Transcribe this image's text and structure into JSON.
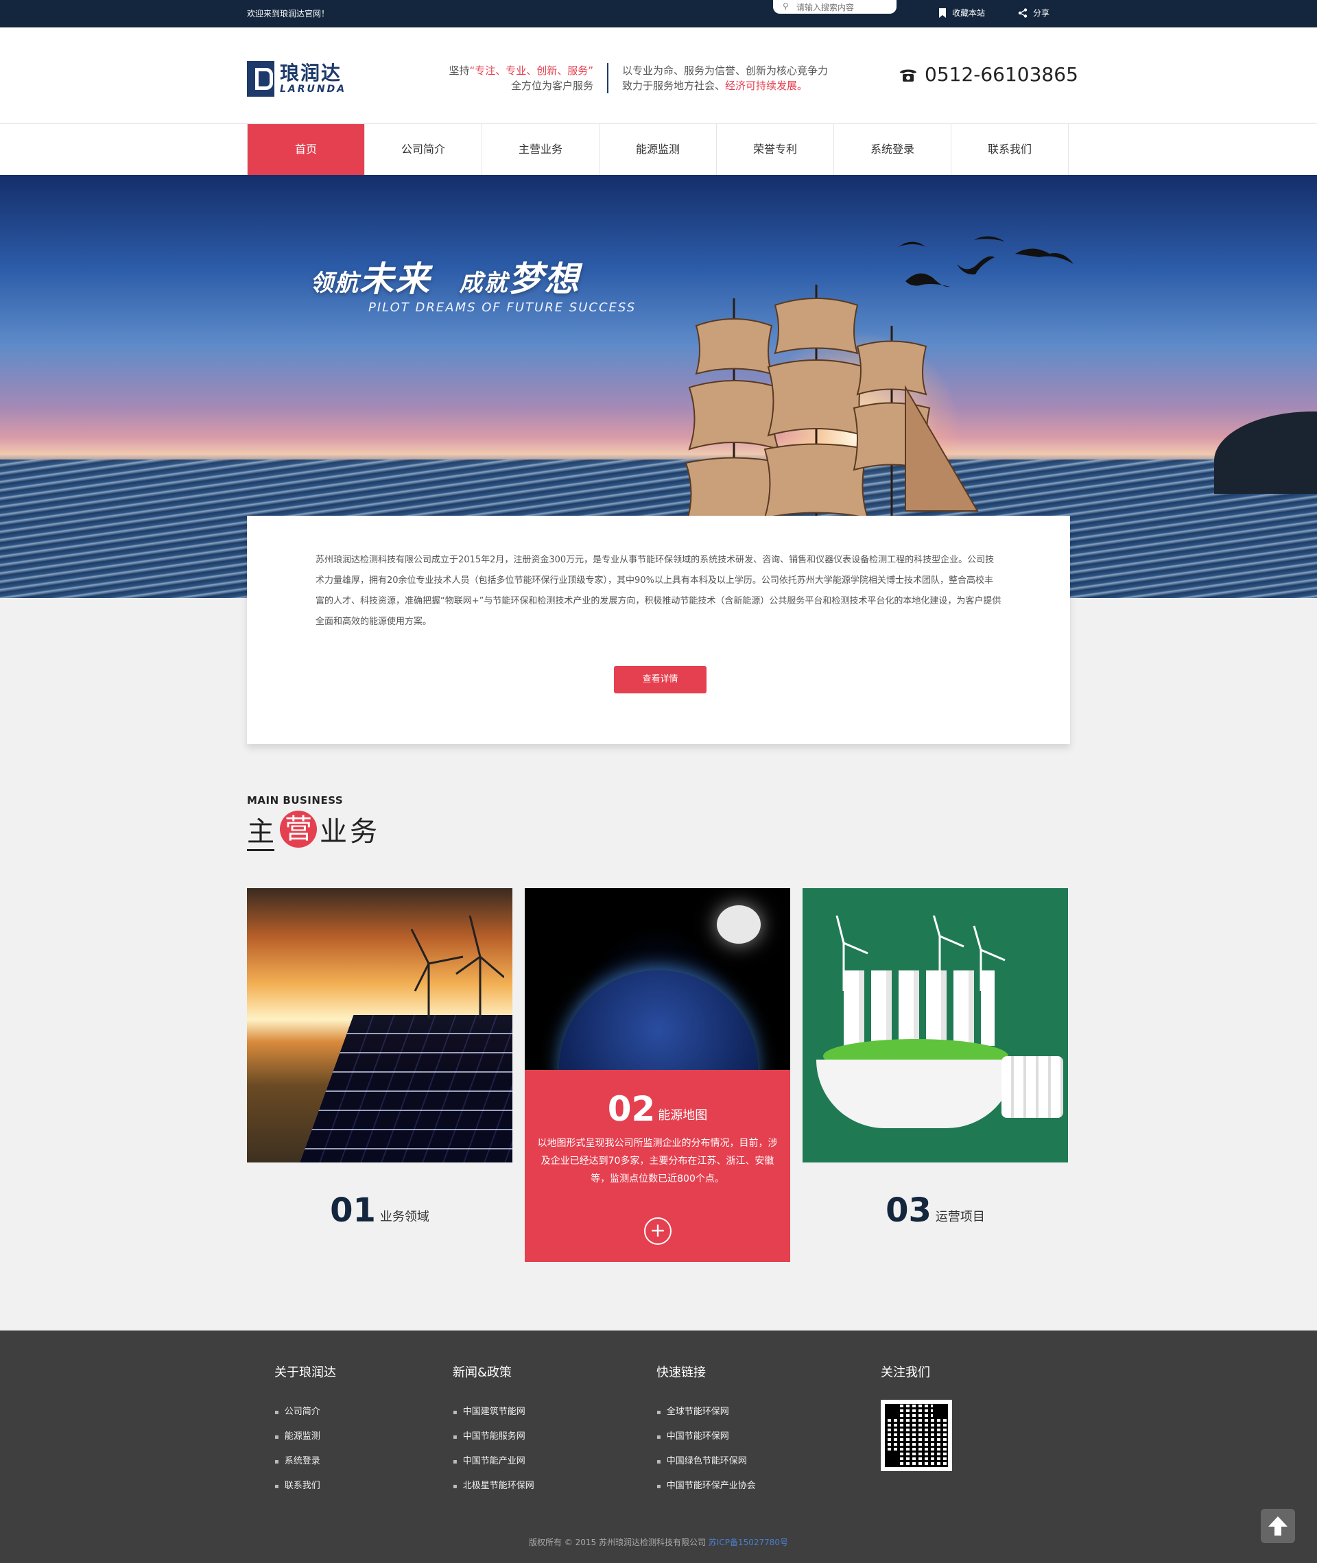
{
  "topbar": {
    "welcome": "欢迎来到琅润达官网！",
    "search_placeholder": "请输入搜索内容",
    "favorite": "收藏本站",
    "share": "分享"
  },
  "header": {
    "logo_cn": "琅润达",
    "logo_en": "LARUNDA",
    "slogan1_pre": "坚持",
    "slogan1_hl": "“专注、专业、创新、服务”",
    "slogan1_line2": "全方位为客户服务",
    "slogan2_line1": "以专业为命、服务为信誉、创新为核心竞争力",
    "slogan2_pre": "致力于服务地方社会、",
    "slogan2_hl": "经济可持续发展。",
    "phone": "0512-66103865"
  },
  "nav": {
    "items": [
      {
        "label": "首页"
      },
      {
        "label": "公司简介"
      },
      {
        "label": "主营业务"
      },
      {
        "label": "能源监测"
      },
      {
        "label": "荣誉专利"
      },
      {
        "label": "系统登录"
      },
      {
        "label": "联系我们"
      }
    ]
  },
  "banner": {
    "cn_part1_small": "领航",
    "cn_part1_big": "未来",
    "cn_part2_small": "成就",
    "cn_part2_big": "梦想",
    "en": "PILOT DREAMS OF FUTURE SUCCESS"
  },
  "intro": {
    "text": "苏州琅润达检测科技有限公司成立于2015年2月，注册资金300万元，是专业从事节能环保领域的系统技术研发、咨询、销售和仪器仪表设备检测工程的科技型企业。公司技术力量雄厚，拥有20余位专业技术人员（包括多位节能环保行业顶级专家），其中90%以上具有本科及以上学历。公司依托苏州大学能源学院相关博士技术团队，整合高校丰富的人才、科技资源，准确把握“物联网+”与节能环保和检测技术产业的发展方向，积极推动节能技术（含新能源）公共服务平台和检测技术平台化的本地化建设，为客户提供全面和高效的能源使用方案。",
    "button": "查看详情"
  },
  "business": {
    "title_en": "MAIN BUSINESS",
    "title_pre": "主",
    "title_circle": "营",
    "title_post": "业务",
    "cards": [
      {
        "num": "01",
        "label": "业务领域"
      },
      {
        "num": "02",
        "label": "能源地图",
        "desc": "以地图形式呈现我公司所监测企业的分布情况，目前，涉及企业已经达到70多家，主要分布在江苏、浙江、安徽等，监测点位数已近800个点。",
        "plus": "+"
      },
      {
        "num": "03",
        "label": "运营项目"
      }
    ]
  },
  "footer": {
    "cols": [
      {
        "title": "关于琅润达",
        "links": [
          "公司简介",
          "能源监测",
          "系统登录",
          "联系我们"
        ]
      },
      {
        "title": "新闻&政策",
        "links": [
          "中国建筑节能网",
          "中国节能服务网",
          "中国节能产业网",
          "北极星节能环保网"
        ]
      },
      {
        "title": "快速链接",
        "links": [
          "全球节能环保网",
          "中国节能环保网",
          "中国绿色节能环保网",
          "中国节能环保产业协会"
        ]
      },
      {
        "title": "关注我们"
      }
    ],
    "copyright": "版权所有 © 2015 苏州琅润达检测科技有限公司",
    "icp": "苏ICP备15027780号"
  },
  "icons": [
    "search-icon",
    "bookmark-icon",
    "share-icon",
    "phone-icon",
    "plus-icon",
    "arrow-up-icon"
  ],
  "colors": {
    "accent": "#e54050",
    "navy": "#13263d",
    "footer": "#3f3f3f"
  }
}
